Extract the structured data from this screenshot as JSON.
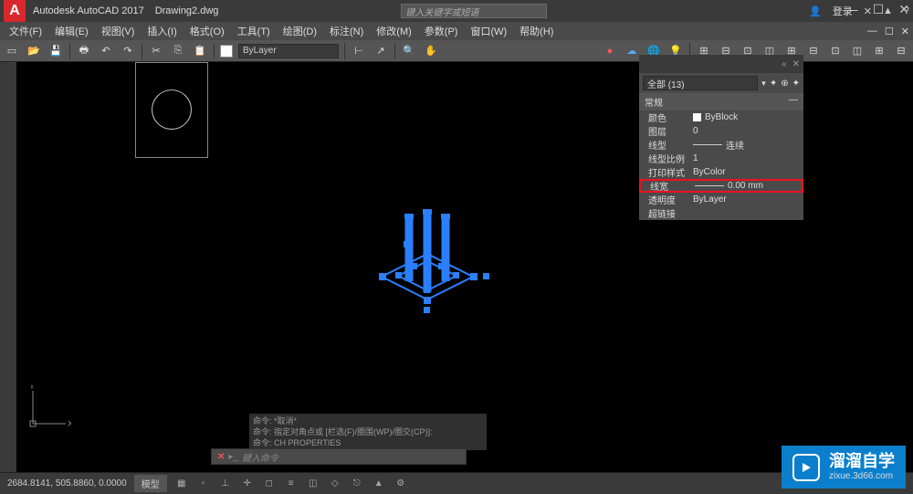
{
  "title": {
    "app": "Autodesk AutoCAD 2017",
    "doc": "Drawing2.dwg",
    "search_placeholder": "键入关键字或短语",
    "login": "登录"
  },
  "menu": {
    "items": [
      "文件(F)",
      "编辑(E)",
      "视图(V)",
      "插入(I)",
      "格式(O)",
      "工具(T)",
      "绘图(D)",
      "标注(N)",
      "修改(M)",
      "参数(P)",
      "窗口(W)",
      "帮助(H)"
    ]
  },
  "toolbar": {
    "layer_dd": "ByLayer"
  },
  "props": {
    "filter": "全部 (13)",
    "section": "常规",
    "rows": [
      {
        "label": "颜色",
        "value": "ByBlock",
        "icon": true
      },
      {
        "label": "图层",
        "value": "0"
      },
      {
        "label": "线型",
        "value": "连续",
        "line": true
      },
      {
        "label": "线型比例",
        "value": "1"
      },
      {
        "label": "打印样式",
        "value": "ByColor"
      },
      {
        "label": "线宽",
        "value": "0.00 mm",
        "line": true,
        "hl": true
      },
      {
        "label": "透明度",
        "value": "ByLayer"
      },
      {
        "label": "超链接",
        "value": ""
      }
    ]
  },
  "cmd": {
    "line1": "命令:  *取消*",
    "line2": "命令: 指定对角点或 [栏选(F)/圈围(WP)/圈交(CP)]:",
    "line3": "命令: CH PROPERTIES",
    "input_placeholder": "键入命令"
  },
  "status": {
    "coords": "2684.8141, 505.8860, 0.0000",
    "model": "模型"
  },
  "watermark": {
    "title": "溜溜自学",
    "sub": "zixue.3d66.com"
  }
}
